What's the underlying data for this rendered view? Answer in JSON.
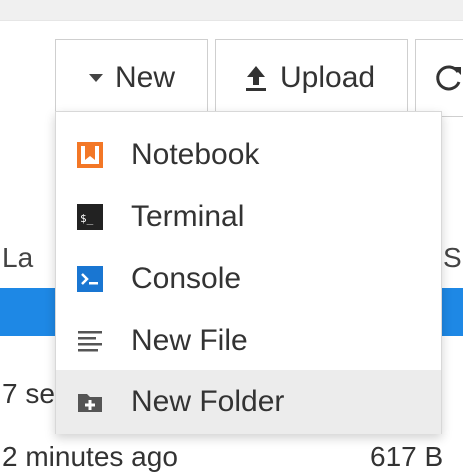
{
  "toolbar": {
    "new_label": "New",
    "upload_label": "Upload"
  },
  "file_list": {
    "header_left": "La",
    "header_right": "Si",
    "row1_text": "7 se",
    "row2_left": "2 minutes ago",
    "row2_right": "617 B"
  },
  "new_menu": {
    "items": [
      {
        "label": "Notebook",
        "icon": "notebook-icon"
      },
      {
        "label": "Terminal",
        "icon": "terminal-icon"
      },
      {
        "label": "Console",
        "icon": "console-icon"
      },
      {
        "label": "New File",
        "icon": "text-file-icon"
      },
      {
        "label": "New Folder",
        "icon": "new-folder-icon"
      }
    ],
    "hovered_item": "New Folder"
  },
  "colors": {
    "notebook": "#f37726",
    "terminal": "#222222",
    "console": "#1976d2",
    "selection": "#1e88e5",
    "hover": "#ececec"
  }
}
